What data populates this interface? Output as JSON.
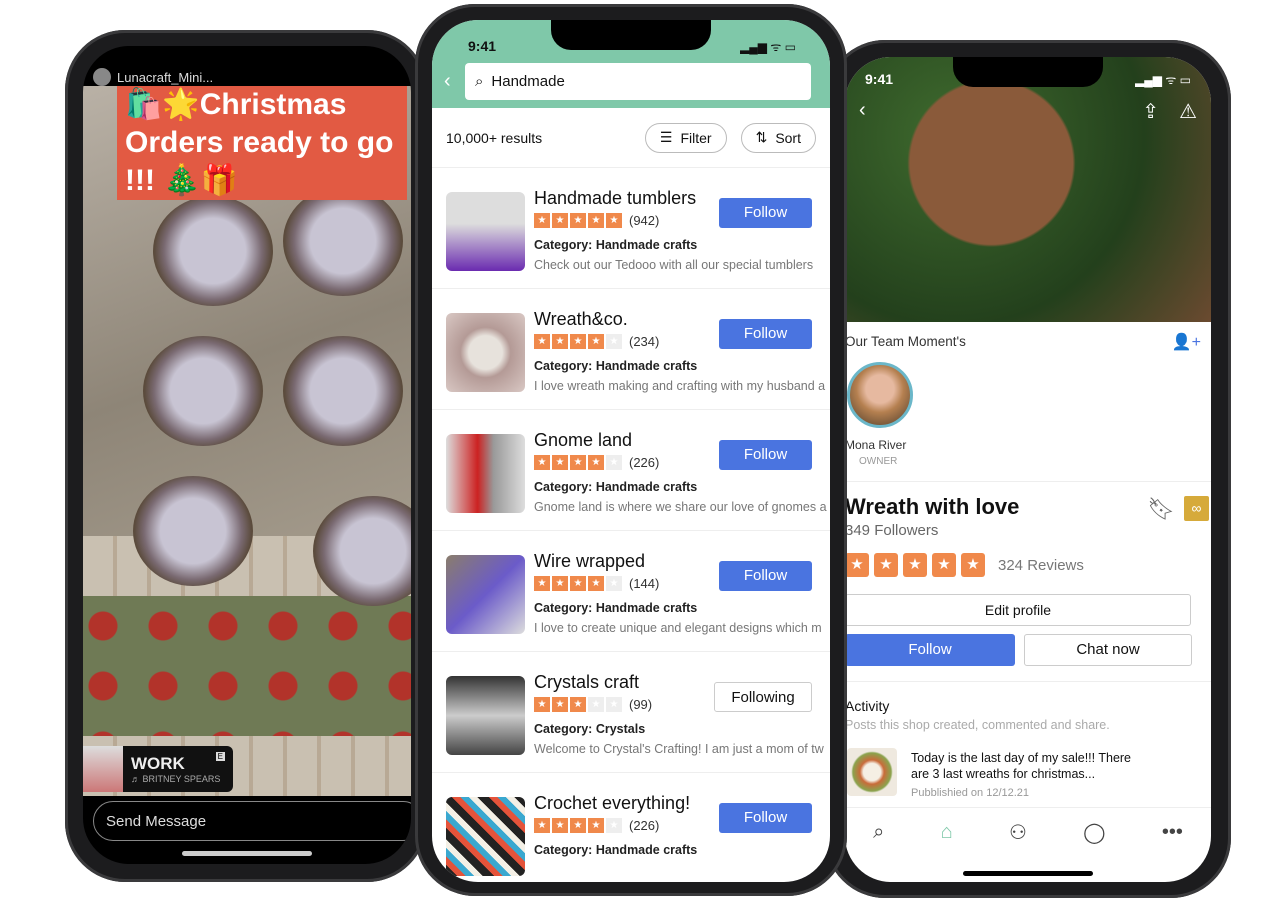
{
  "story": {
    "username": "Lunacraft_Mini...",
    "caption": "🛍️🌟Christmas Orders ready to go !!! 🎄🎁",
    "music_title": "WORK",
    "music_artist": "♬ BRITNEY SPEARS",
    "explicit": "E",
    "send_placeholder": "Send Message"
  },
  "search_screen": {
    "time": "9:41",
    "status": "▂▄▆ ᯤ ▭",
    "back_icon": "chevron-left",
    "query": "Handmade",
    "results": "10,000+ results",
    "filter": "Filter",
    "sort": "Sort",
    "header_color": "#7fc8a9",
    "accent": "#4a74e0",
    "star_color": "#f0894b",
    "items": [
      {
        "name": "Handmade tumblers",
        "rating": 5,
        "reviews": "(942)",
        "category": "Category: Handmade crafts",
        "description": "Check out our Tedooo with all our special tumblers",
        "button": "Follow",
        "following": false
      },
      {
        "name": "Wreath&co.",
        "rating": 4,
        "reviews": "(234)",
        "category": "Category: Handmade crafts",
        "description": "I love wreath making and crafting with my husband a",
        "button": "Follow",
        "following": false
      },
      {
        "name": "Gnome land",
        "rating": 4,
        "reviews": "(226)",
        "category": "Category: Handmade crafts",
        "description": "Gnome land is where we share our love of gnomes a",
        "button": "Follow",
        "following": false
      },
      {
        "name": "Wire wrapped",
        "rating": 4,
        "reviews": "(144)",
        "category": "Category: Handmade crafts",
        "description": "I love to create unique and elegant designs which m",
        "button": "Follow",
        "following": false
      },
      {
        "name": "Crystals craft",
        "rating": 3,
        "reviews": "(99)",
        "category": "Category: Crystals",
        "description": "Welcome to Crystal's Crafting! I am just a mom of tw",
        "button": "Following",
        "following": true
      },
      {
        "name": "Crochet everything!",
        "rating": 4,
        "reviews": "(226)",
        "category": "Category: Handmade crafts",
        "description": "",
        "button": "Follow",
        "following": false
      }
    ]
  },
  "shop_screen": {
    "time": "9:41",
    "status": "▂▄▆ ᯤ ▭",
    "team_heading": "Our Team Moment's",
    "member_name": "Mona River",
    "member_role": "OWNER",
    "shop_name": "Wreath with love",
    "followers": "349 Followers",
    "rating": 5,
    "reviews": "324 Reviews",
    "edit_profile": "Edit profile",
    "follow": "Follow",
    "chat": "Chat now",
    "activity_heading": "Activity",
    "activity_sub": "Posts this shop created, commented and share.",
    "post_text": "Today is the last day of my sale!!! There are 3 last wreaths for christmas...",
    "post_date": "Pubblishied on 12/12.21",
    "tabs": [
      "search",
      "home",
      "profile",
      "chat",
      "more"
    ],
    "active_tab": "home"
  }
}
